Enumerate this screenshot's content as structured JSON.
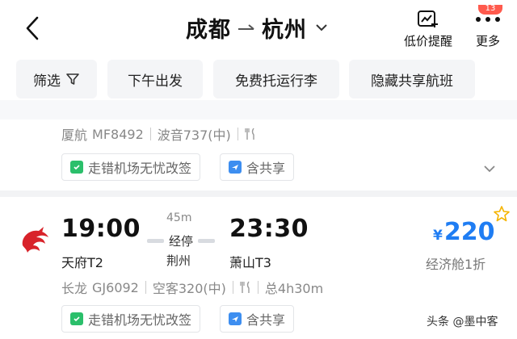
{
  "header": {
    "origin": "成都",
    "destination": "杭州",
    "price_alert_label": "低价提醒",
    "more_label": "更多",
    "badge": "13"
  },
  "filters": [
    "筛选",
    "下午出发",
    "免费托运行李",
    "隐藏共享航班"
  ],
  "flights": [
    {
      "airline": "厦航",
      "flight_no": "MF8492",
      "aircraft": "波音737(中)",
      "tags": [
        "走错机场无忧改签",
        "含共享"
      ]
    },
    {
      "depart_time": "19:00",
      "depart_airport": "天府T2",
      "duration_short": "45m",
      "stop_label": "经停",
      "stop_city": "荆州",
      "arrive_time": "23:30",
      "arrive_airport": "萧山T3",
      "price_currency": "¥",
      "price": "220",
      "cabin": "经济舱1折",
      "airline": "长龙",
      "flight_no": "GJ6092",
      "aircraft": "空客320(中)",
      "total_duration": "总4h30m",
      "tags": [
        "走错机场无忧改签",
        "含共享"
      ]
    }
  ],
  "watermark": "头条 @墨中客",
  "colors": {
    "accent": "#1f7df3",
    "green_tag": "#2bbf6b",
    "blue_tag": "#3d8ef0",
    "badge": "#ff5a4d"
  },
  "icons": [
    "back-arrow-icon",
    "route-arrow-icon",
    "chevron-down-icon",
    "price-alert-chart-icon",
    "more-dots-icon",
    "filter-funnel-icon",
    "meal-icon",
    "shield-check-icon",
    "plane-share-icon",
    "airline-logo",
    "star-outline-icon"
  ]
}
